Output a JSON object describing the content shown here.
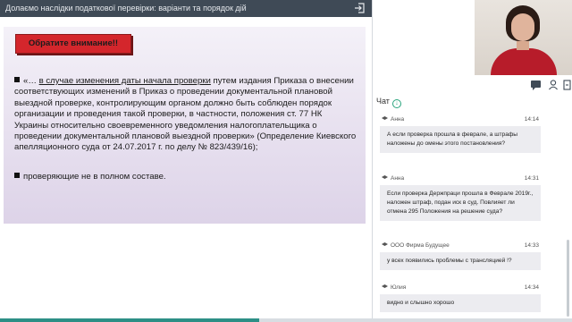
{
  "header": {
    "title": "Долаємо наслідки податкової перевірки: варіанти та порядок дій"
  },
  "slide": {
    "attention_label": "Обратите внимание!!",
    "bullet1_prefix": "«… ",
    "bullet1_underlined": "в случае изменения даты начала проверки",
    "bullet1_rest": " путем издания Приказа о внесении соответствующих изменений в Приказ о проведении документальной плановой выездной проверке, контролирующим органом должно быть соблюден порядок организации и проведения такой проверки, в частности, положения ст. 77 НК Украины относительно своевременного уведомления налогоплательщика о проведении документальной плановой выездной проверки» (Определение Киевского апелляционного суда от 24.07.2017 г. по делу № 823/439/16);",
    "bullet2": "проверяющие не в полном составе."
  },
  "chat": {
    "title": "Чат",
    "messages": [
      {
        "name": "Анна",
        "time": "14:14",
        "text": "А если проверка прошла в феврале, а штрафы наложены до омены этого постановления?"
      },
      {
        "name": "Анна",
        "time": "14:31",
        "text": "Если проверка Держпраци прошла в Феврале 2019г., наложен штраф, подан иск в суд. Повлияет ли отмена 295 Положения на решение суда?"
      },
      {
        "name": "ООО Фирма Будущее",
        "time": "14:33",
        "text": "у всех появились проблемы с трансляцией !?"
      },
      {
        "name": "Юлия",
        "time": "14:34",
        "text": "видно и слышно хорошо"
      }
    ]
  },
  "playback": {
    "progress_fraction": 0.453
  },
  "colors": {
    "topbar": "#3f4a56",
    "attention": "#d4262c",
    "accent": "#2d8f86",
    "bubble": "#ececf0"
  }
}
